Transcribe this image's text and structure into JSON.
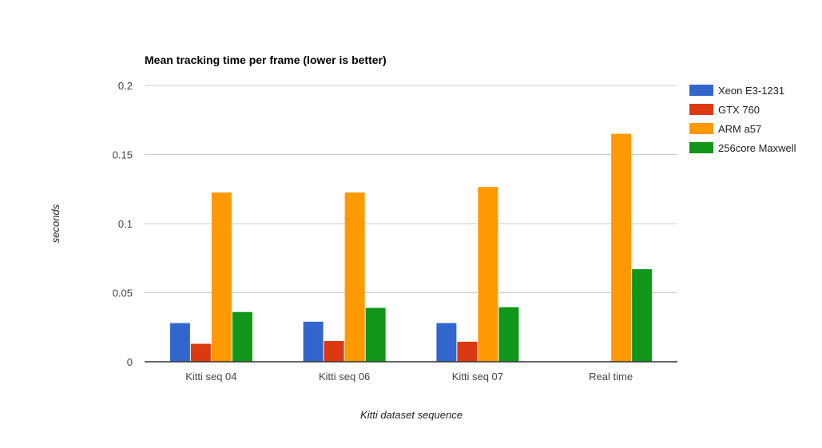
{
  "chart_data": {
    "type": "bar",
    "title": "Mean tracking time per frame (lower is better)",
    "xlabel": "Kitti dataset sequence",
    "ylabel": "seconds",
    "ylim": [
      0,
      0.2
    ],
    "yticks": [
      0,
      0.05,
      0.1,
      0.15,
      0.2
    ],
    "ytick_labels": [
      "0",
      "0.05",
      "0.1",
      "0.15",
      "0.2"
    ],
    "grid": true,
    "legend_position": "right",
    "categories": [
      "Kitti seq 04",
      "Kitti seq 06",
      "Kitti seq 07",
      "Real time"
    ],
    "series": [
      {
        "name": "Xeon E3-1231",
        "color": "#3366cc",
        "values": [
          0.028,
          0.029,
          0.028,
          null
        ]
      },
      {
        "name": "GTX 760",
        "color": "#dc3912",
        "values": [
          0.013,
          0.015,
          0.0145,
          null
        ]
      },
      {
        "name": "ARM a57",
        "color": "#ff9900",
        "values": [
          0.1225,
          0.1225,
          0.1265,
          0.165
        ]
      },
      {
        "name": "256core Maxwell",
        "color": "#109618",
        "values": [
          0.036,
          0.039,
          0.0395,
          0.067
        ]
      }
    ]
  }
}
